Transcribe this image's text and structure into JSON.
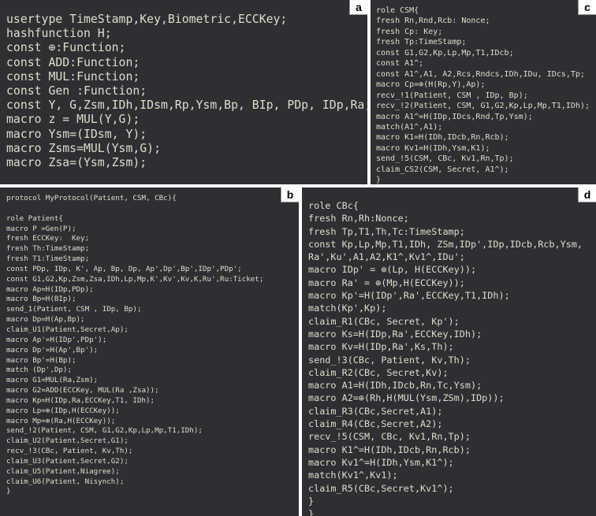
{
  "panels": {
    "a": {
      "label": "a",
      "lines": [
        "usertype TimeStamp,Key,Biometric,ECCKey;",
        "hashfunction H;",
        "const ⊕:Function;",
        "const ADD:Function;",
        "const MUL:Function;",
        "const Gen :Function;",
        "const Y, G,Zsm,IDh,IDsm,Rp,Ysm,Bp, BIp, PDp, IDp,Ra;",
        "macro z = MUL(Y,G);",
        "macro Ysm=(IDsm, Y);",
        "macro Zsms=MUL(Ysm,G);",
        "macro Zsa=(Ysm,Zsm);"
      ]
    },
    "b": {
      "label": "b",
      "lines": [
        "protocol MyProtocol(Patient, CSM, CBc){",
        "",
        "role Patient{",
        "macro P =Gen(P);",
        "fresh ECCKey:  Key;",
        "fresh Th:TimeStamp;",
        "fresh T1:TimeStamp;",
        "const PDp, IDp, K', Ap, Bp, Dp, Ap',Dp',Bp',IDp',PDp';",
        "const G1,G2,Kp,Zsm,Zsa,IDh,Lp,Mp,K',Kv',Kv,K,Ru',Ru:Ticket;",
        "macro Ap=H(IDp,PDp);",
        "macro Bp=H(BIp);",
        "send_1(Patient, CSM , IDp, Bp);",
        "macro Dp=H(Ap,Bp);",
        "claim_U1(Patient,Secret,Ap);",
        "macro Ap'=H(IDp',PDp');",
        "macro Dp'=H(Ap',Bp');",
        "macro Bp'=H(Bp);",
        "match (Dp',Dp);",
        "macro G1=MUL(Ra,Zsm);",
        "macro G2=ADD(ECCKey, MUL(Ra ,Zsa));",
        "macro Kp=H(IDp,Ra,ECCKey,T1, IDh);",
        "macro Lp=⊕(IDp,H(ECCKey));",
        "macro Mp=⊕(Ra,H(ECCKey));",
        "send_!2(Patient, CSM, G1,G2,Kp,Lp,Mp,T1,IDh);",
        "claim_U2(Patient,Secret,G1);",
        "recv_!3(CBc, Patient, Kv,Th);",
        "claim_U3(Patient,Secret,G2);",
        "claim_U5(Patient,Niagree);",
        "claim_U6(Patient, Nisynch);",
        "}"
      ]
    },
    "c": {
      "label": "c",
      "lines": [
        "role CSM{",
        "fresh Rn,Rnd,Rcb: Nonce;",
        "fresh Cp: Key;",
        "fresh Tp:TimeStamp;",
        "const G1,G2,Kp,Lp,Mp,T1,IDcb;",
        "const A1^;",
        "const A1^,A1, A2,Rcs,Rndcs,IDh,IDu, IDcs,Tp;",
        "macro Cp=⊕(H(Rp,Y),Ap);",
        "recv_!1(Patient, CSM , IDp, Bp);",
        "recv_!2(Patient, CSM, G1,G2,Kp,Lp,Mp,T1,IDh);",
        "macro A1^=H(IDp,IDcs,Rnd,Tp,Ysm);",
        "match(A1^,A1);",
        "macro K1=H(IDh,IDcb,Rn,Rcb);",
        "macro Kv1=H(IDh,Ysm,K1);",
        "send_!5(CSM, CBc, Kv1,Rn,Tp);",
        "claim_CS2(CSM, Secret, A1^);",
        "}"
      ]
    },
    "d": {
      "label": "d",
      "lines": [
        "role CBc{",
        "fresh Rn,Rh:Nonce;",
        "fresh Tp,T1,Th,Tc:TimeStamp;",
        "const Kp,Lp,Mp,T1,IDh, ZSm,IDp',IDp,IDcb,Rcb,Ysm,",
        "Ra',Ku',A1,A2,K1^,Kv1^,IDu';",
        "macro IDp' = ⊕(Lp, H(ECCKey));",
        "macro Ra' = ⊕(Mp,H(ECCKey));",
        "macro Kp'=H(IDp',Ra',ECCKey,T1,IDh);",
        "match(Kp',Kp);",
        "claim_R1(CBc, Secret, Kp');",
        "macro Ks=H(IDp,Ra',ECCKey,IDh);",
        "macro Kv=H(IDp,Ra',Ks,Th);",
        "send_!3(CBc, Patient, Kv,Th);",
        "claim_R2(CBc, Secret,Kv);",
        "macro A1=H(IDh,IDcb,Rn,Tc,Ysm);",
        "macro A2=⊕(Rh,H(MUL(Ysm,ZSm),IDp));",
        "claim_R3(CBc,Secret,A1);",
        "claim_R4(CBc,Secret,A2);",
        "recv_!5(CSM, CBc, Kv1,Rn,Tp);",
        "macro K1^=H(IDh,IDcb,Rn,Rcb);",
        "macro Kv1^=H(IDh,Ysm,K1^);",
        "match(Kv1^,Kv1);",
        "claim_R5(CBc,Secret,Kv1^);",
        "}",
        "}"
      ]
    }
  },
  "colors": {
    "panel_bg": "#2d2f33",
    "text": "#e0dcc8",
    "highlight_magenta": "#d97fb4",
    "highlight_cyan": "#7fd3c6"
  }
}
